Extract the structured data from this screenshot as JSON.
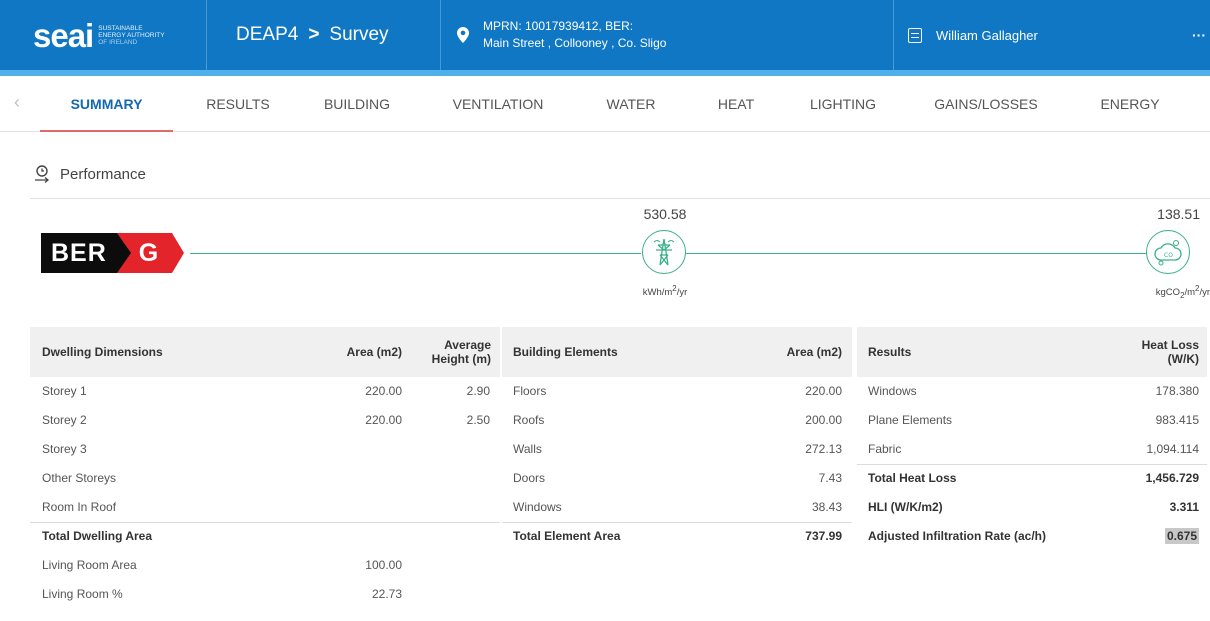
{
  "header": {
    "logo_word": "seai",
    "logo_sub_lines": [
      "SUSTAINABLE",
      "ENERGY AUTHORITY",
      "OF IRELAND"
    ],
    "app": "DEAP4",
    "separator": ">",
    "section": "Survey",
    "address_line1": "MPRN: 10017939412, BER:",
    "address_line2": "Main Street , Collooney , Co. Sligo",
    "user": "William Gallagher",
    "more": "···",
    "colors": {
      "bar": "#0f77c4",
      "accent": "#4fb0ea"
    }
  },
  "tabs": [
    {
      "label": "SUMMARY",
      "active": true
    },
    {
      "label": "RESULTS",
      "active": false
    },
    {
      "label": "BUILDING",
      "active": false
    },
    {
      "label": "VENTILATION",
      "active": false
    },
    {
      "label": "WATER",
      "active": false
    },
    {
      "label": "HEAT",
      "active": false
    },
    {
      "label": "LIGHTING",
      "active": false
    },
    {
      "label": "GAINS/LOSSES",
      "active": false
    },
    {
      "label": "ENERGY",
      "active": false
    }
  ],
  "tab_back": "‹",
  "performance": {
    "title": "Performance",
    "ber_label": "BER",
    "ber_rating": "G",
    "energy_value": "530.58",
    "energy_unit_pre": "kWh/m",
    "energy_unit_sup": "2",
    "energy_unit_post": "/yr",
    "co2_value": "138.51",
    "co2_unit_pre": "kgCO",
    "co2_unit_sub": "2",
    "co2_unit_mid": "/m",
    "co2_unit_sup": "2",
    "co2_unit_post": "/yr",
    "co2_icon_text": "CO",
    "colors": {
      "track": "#3bb08a",
      "ber_red": "#e3242b"
    }
  },
  "dwelling": {
    "headers": {
      "name": "Dwelling Dimensions",
      "area": "Area (m2)",
      "height": "Average Height (m)"
    },
    "rows": [
      {
        "name": "Storey 1",
        "area": "220.00",
        "height": "2.90"
      },
      {
        "name": "Storey 2",
        "area": "220.00",
        "height": "2.50"
      },
      {
        "name": "Storey 3",
        "area": "",
        "height": ""
      },
      {
        "name": "Other Storeys",
        "area": "",
        "height": ""
      },
      {
        "name": "Room In Roof",
        "area": "",
        "height": ""
      }
    ],
    "total_label": "Total Dwelling Area",
    "living_area_label": "Living Room Area",
    "living_area_value": "100.00",
    "living_pct_label": "Living Room %",
    "living_pct_value": "22.73"
  },
  "elements": {
    "headers": {
      "name": "Building Elements",
      "area": "Area (m2)"
    },
    "rows": [
      {
        "name": "Floors",
        "area": "220.00"
      },
      {
        "name": "Roofs",
        "area": "200.00"
      },
      {
        "name": "Walls",
        "area": "272.13"
      },
      {
        "name": "Doors",
        "area": "7.43"
      },
      {
        "name": "Windows",
        "area": "38.43"
      }
    ],
    "total_label": "Total Element Area",
    "total_value": "737.99"
  },
  "results": {
    "headers": {
      "name": "Results",
      "loss": "Heat Loss (W/K)"
    },
    "rows": [
      {
        "name": "Windows",
        "value": "178.380"
      },
      {
        "name": "Plane Elements",
        "value": "983.415"
      },
      {
        "name": "Fabric",
        "value": "1,094.114"
      }
    ],
    "total_loss_label": "Total Heat Loss",
    "total_loss_value": "1,456.729",
    "hli_label": "HLI (W/K/m2)",
    "hli_value": "3.311",
    "infil_label": "Adjusted Infiltration Rate (ac/h)",
    "infil_value": "0.675"
  }
}
